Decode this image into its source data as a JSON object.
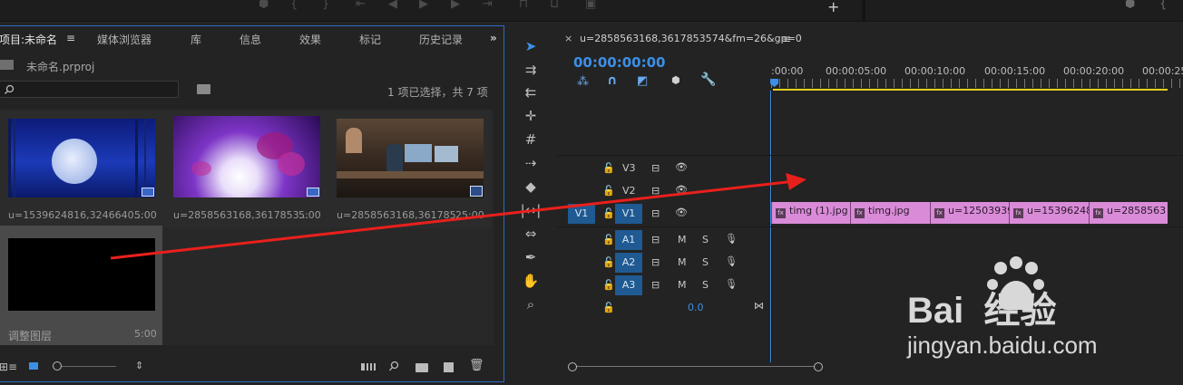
{
  "project_panel": {
    "tabs": [
      "项目:未命名",
      "媒体浏览器",
      "库",
      "信息",
      "效果",
      "标记",
      "历史记录"
    ],
    "tab_menu_glyph": "≡",
    "overflow_glyph": "»",
    "file_name": "未命名.prproj",
    "selection_status": "1 项已选择，共 7 项",
    "items": [
      {
        "name": "u=1539624816,3246640...",
        "duration": "5:00"
      },
      {
        "name": "u=2858563168,3617853...",
        "duration": "5:00"
      },
      {
        "name": "u=2858563168,361785...",
        "duration": "25:00"
      },
      {
        "name": "调整图层",
        "duration": "5:00"
      }
    ]
  },
  "timeline": {
    "sequence_tab": "u=2858563168,3617853574&fm=26&gp=0",
    "close_glyph": "×",
    "menu_glyph": "≡",
    "timecode": "00:00:00:00",
    "ruler_labels": [
      ":00:00",
      "00:00:05:00",
      "00:00:10:00",
      "00:00:15:00",
      "00:00:20:00",
      "00:00:25"
    ],
    "video_tracks": [
      "V3",
      "V2",
      "V1"
    ],
    "source_patch": "V1",
    "audio_tracks": [
      "A1",
      "A2",
      "A3"
    ],
    "audio_buttons": {
      "mute": "M",
      "solo": "S"
    },
    "master_level": "0.0",
    "clips": [
      "timg (1).jpg",
      "timg.jpg",
      "u=12503939",
      "u=15396248",
      "u=2858563"
    ]
  },
  "watermark": {
    "brand": "Bai  经验",
    "url": "jingyan.baidu.com"
  },
  "colors": {
    "accent_blue": "#2e6bc7",
    "clip_pink": "#d98bd8",
    "timecode_blue": "#3c8fe6",
    "arrow_red": "#e8201c",
    "work_area_yellow": "#e3d11f"
  }
}
